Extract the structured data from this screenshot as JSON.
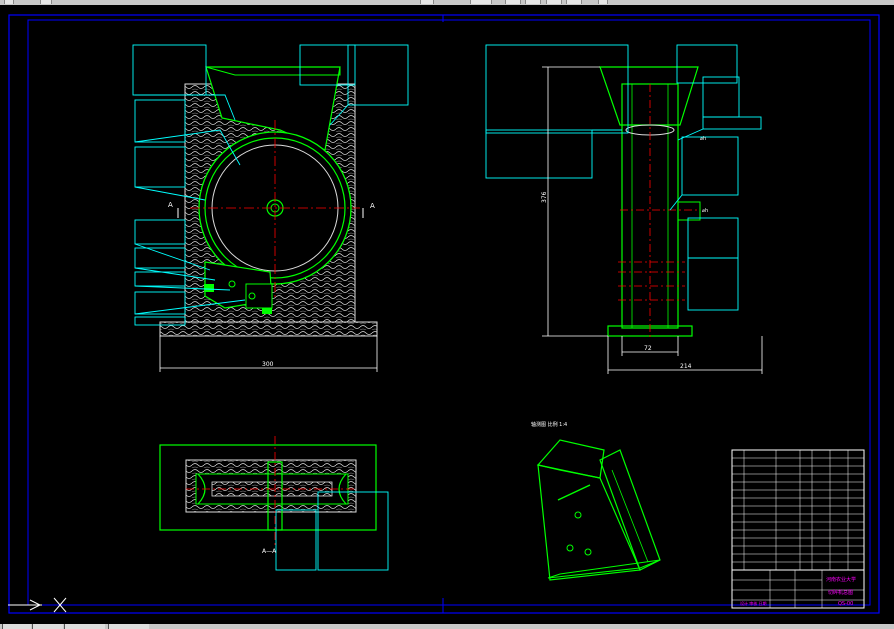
{
  "dimensions": {
    "main_width": "300",
    "side_height": "376",
    "side_base_inner": "72",
    "side_base_outer": "214"
  },
  "section_marks": {
    "left": "A",
    "right": "A",
    "section_view_label": "A—A"
  },
  "view_labels": {
    "isometric": "轴测图 比例 1:4"
  },
  "title_block": {
    "school": "河南农业大学",
    "drawing_name": "切碎机总图",
    "drawing_no": "QS-00",
    "designer": "设计 审核 日期"
  },
  "colors": {
    "background": "#000000",
    "frame": "#0000ff",
    "outline": "#ffffff",
    "part_line": "#00ff00",
    "leader": "#00ffff",
    "center_line": "#ff0000",
    "title": "#ff00ff"
  },
  "icons": [
    "ucs-icon"
  ]
}
